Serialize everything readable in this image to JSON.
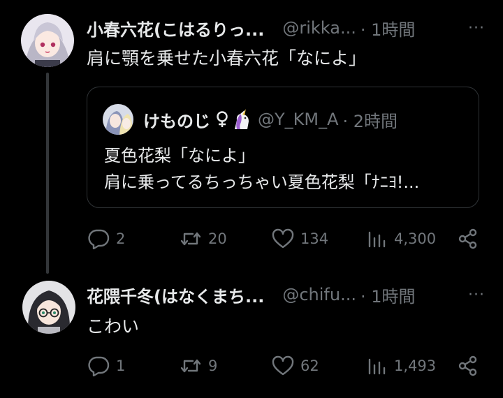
{
  "tweets": [
    {
      "display_name": "小春六花(こはるりっ...",
      "handle": "@rikka...",
      "time": "· 1時間",
      "more": "···",
      "text": "肩に顎を乗せた小春六花「なによ」",
      "quote": {
        "display_name": "けものじ",
        "emoji": "♀🦄",
        "handle": "@Y_KM_A",
        "time": "· 2時間",
        "lines": [
          "夏色花梨「なによ」",
          "肩に乗ってるちっちゃい夏色花梨「ﾅﾆﾖ!..."
        ]
      },
      "actions": {
        "replies": "2",
        "retweets": "20",
        "likes": "134",
        "views": "4,300"
      }
    },
    {
      "display_name": "花隈千冬(はなくまち...",
      "handle": "@chifu...",
      "time": "· 1時間",
      "more": "···",
      "text": "こわい",
      "actions": {
        "replies": "1",
        "retweets": "9",
        "likes": "62",
        "views": "1,493"
      }
    }
  ],
  "colors": {
    "background": "#000000",
    "text": "#e7e9ea",
    "muted": "#71767b",
    "border": "#2f3336"
  }
}
